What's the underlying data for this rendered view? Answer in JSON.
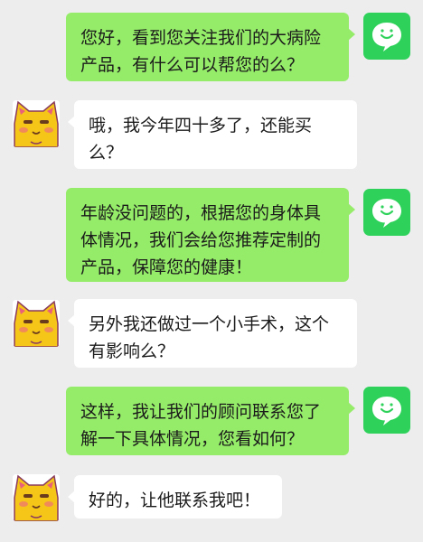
{
  "colors": {
    "background": "#ededed",
    "sent_bubble": "#95ec69",
    "received_bubble": "#ffffff",
    "sender_avatar": "#2ed25a",
    "receiver_avatar_face": "#f5c518"
  },
  "icons": {
    "sender_avatar": "wechat-chat-bubble-icon",
    "receiver_avatar": "cartoon-cat-icon"
  },
  "messages": [
    {
      "side": "sent",
      "text": "您好，看到您关注我们的大病险\n产品，有什么可以帮您的么？"
    },
    {
      "side": "received",
      "text": "哦，我今年四十多了，还能买\n么？"
    },
    {
      "side": "sent",
      "text": "年龄没问题的，根据您的身体具\n体情况，我们会给您推荐定制的\n产品，保障您的健康！"
    },
    {
      "side": "received",
      "text": "另外我还做过一个小手术，这个\n有影响么？"
    },
    {
      "side": "sent",
      "text": "这样，我让我们的顾问联系您了\n解一下具体情况，您看如何？"
    },
    {
      "side": "received",
      "text": "好的，让他联系我吧！"
    }
  ]
}
